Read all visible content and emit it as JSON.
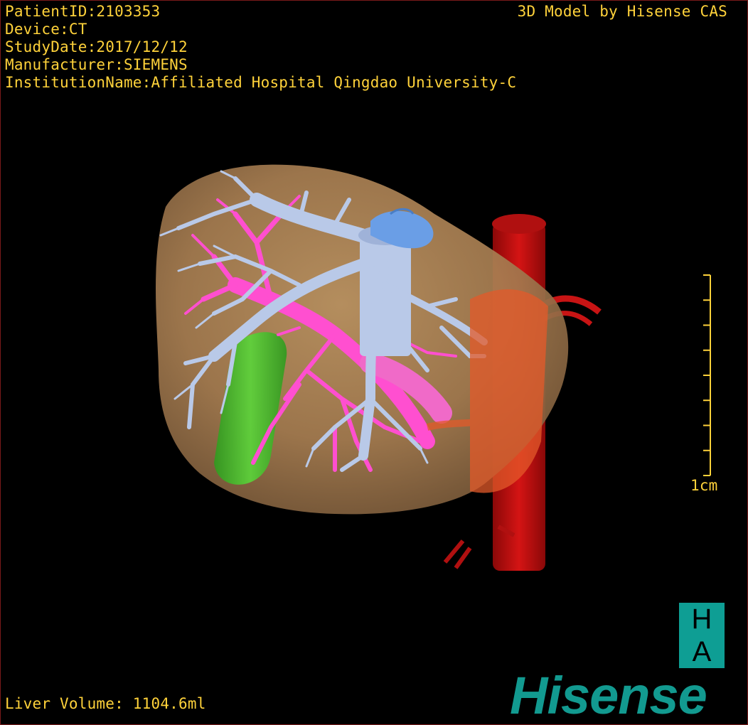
{
  "overlay": {
    "patient_id": "PatientID:2103353",
    "device": "Device:CT",
    "study_date": "StudyDate:2017/12/12",
    "manufacturer": "Manufacturer:SIEMENS",
    "institution": "InstitutionName:Affiliated Hospital Qingdao University-C",
    "credit": "3D Model by Hisense CAS",
    "liver_volume": "Liver Volume: 1104.6ml"
  },
  "scale_bar": {
    "label": "1cm",
    "ticks": 9
  },
  "logo": {
    "ha_top": "H",
    "ha_bottom": "A",
    "brand": "Hisense"
  },
  "colors": {
    "overlay_text": "#ffd23a",
    "liver": "#b0875a",
    "portal_vein": "#ff4fd0",
    "hepatic_vein": "#b9c9e8",
    "artery": "#c0100f",
    "gallbladder": "#3ec22a",
    "ivc_cap": "#6a9ee6",
    "brand": "#129a90"
  },
  "icons": [
    "liver-3d-model-icon",
    "scale-bar-icon",
    "ha-logo-icon"
  ]
}
